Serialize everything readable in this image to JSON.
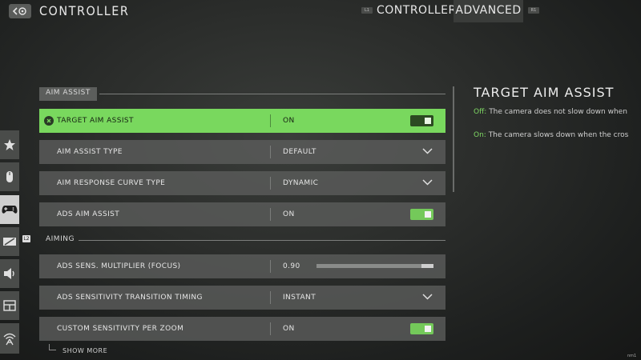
{
  "header": {
    "title": "CONTROLLER",
    "tabs": [
      {
        "label": "CONTROLLER",
        "hint": "L1"
      },
      {
        "label": "ADVANCED",
        "hint": "R1"
      }
    ]
  },
  "sidebar": {
    "items": [
      {
        "icon": "star-icon"
      },
      {
        "icon": "mouse-icon"
      },
      {
        "icon": "gamepad-icon"
      },
      {
        "icon": "display-icon"
      },
      {
        "icon": "speaker-icon"
      },
      {
        "icon": "interface-icon"
      },
      {
        "icon": "network-icon"
      }
    ],
    "badge": "L2"
  },
  "sections": {
    "aim_assist": "AIM ASSIST",
    "aiming": "AIMING"
  },
  "settings": {
    "target_aim_assist": {
      "label": "TARGET AIM ASSIST",
      "value": "ON",
      "enabled": true
    },
    "aim_assist_type": {
      "label": "AIM ASSIST TYPE",
      "value": "DEFAULT"
    },
    "aim_response_curve": {
      "label": "AIM RESPONSE CURVE TYPE",
      "value": "DYNAMIC"
    },
    "ads_aim_assist": {
      "label": "ADS AIM ASSIST",
      "value": "ON",
      "enabled": true
    },
    "ads_sens_multiplier": {
      "label": "ADS SENS. MULTIPLIER (FOCUS)",
      "value": "0.90",
      "slider_level": 0.9
    },
    "ads_transition_timing": {
      "label": "ADS SENSITIVITY TRANSITION TIMING",
      "value": "INSTANT"
    },
    "custom_sens_per_zoom": {
      "label": "CUSTOM SENSITIVITY PER ZOOM",
      "value": "ON",
      "enabled": true
    }
  },
  "show_more": "SHOW MORE",
  "detail": {
    "title": "TARGET AIM ASSIST",
    "off_key": "Off:",
    "off_text": " The camera does not slow down when",
    "on_key": "On:",
    "on_text": " The camera slows down when the cros"
  },
  "corner_text": "nm1",
  "colors": {
    "accent_green": "#79d85e",
    "toggle_green": "#74c95a",
    "row_bg": "#5a5c5a",
    "detail_key": "#7fd864"
  }
}
